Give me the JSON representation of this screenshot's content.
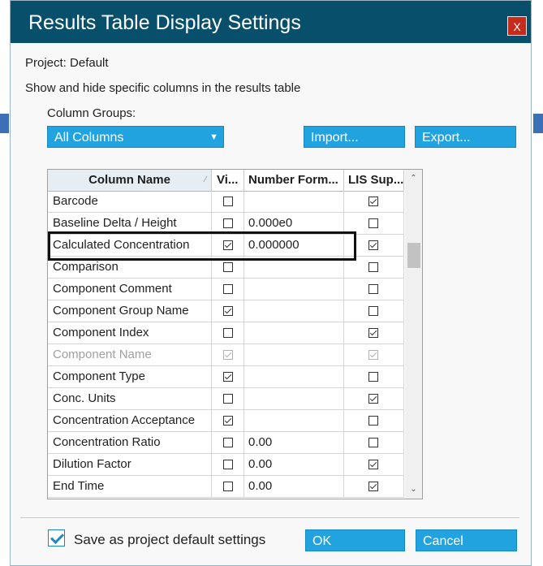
{
  "dialog": {
    "title": "Results Table Display Settings",
    "close_label": "X",
    "project_label": "Project:  Default",
    "description": "Show and hide specific columns in the results table",
    "column_groups_label": "Column Groups:",
    "column_groups_selected": "All Columns",
    "import_label": "Import...",
    "export_label": "Export..."
  },
  "table": {
    "headers": {
      "name": "Column Name",
      "visible": "Vi...",
      "format": "Number  Form...",
      "lis": "LIS  Sup..."
    },
    "rows": [
      {
        "name": "Barcode",
        "visible": false,
        "format": "",
        "lis": true,
        "disabled": false
      },
      {
        "name": "Baseline Delta / Height",
        "visible": false,
        "format": "0.000e0",
        "lis": false,
        "disabled": false
      },
      {
        "name": "Calculated Concentration",
        "visible": true,
        "format": "0.000000",
        "lis": true,
        "disabled": false
      },
      {
        "name": "Comparison",
        "visible": false,
        "format": "",
        "lis": false,
        "disabled": false
      },
      {
        "name": "Component Comment",
        "visible": false,
        "format": "",
        "lis": false,
        "disabled": false
      },
      {
        "name": "Component Group Name",
        "visible": true,
        "format": "",
        "lis": false,
        "disabled": false
      },
      {
        "name": "Component Index",
        "visible": false,
        "format": "",
        "lis": true,
        "disabled": false
      },
      {
        "name": "Component Name",
        "visible": true,
        "format": "",
        "lis": true,
        "disabled": true
      },
      {
        "name": "Component Type",
        "visible": true,
        "format": "",
        "lis": false,
        "disabled": false
      },
      {
        "name": "Conc. Units",
        "visible": false,
        "format": "",
        "lis": true,
        "disabled": false
      },
      {
        "name": "Concentration Acceptance",
        "visible": true,
        "format": "",
        "lis": false,
        "disabled": false
      },
      {
        "name": "Concentration Ratio",
        "visible": false,
        "format": "0.00",
        "lis": false,
        "disabled": false
      },
      {
        "name": "Dilution Factor",
        "visible": false,
        "format": "0.00",
        "lis": true,
        "disabled": false
      },
      {
        "name": "End Time",
        "visible": false,
        "format": "0.00",
        "lis": true,
        "disabled": false
      }
    ]
  },
  "footer": {
    "save_default_label": "Save as project default settings",
    "save_default_checked": true,
    "ok_label": "OK",
    "cancel_label": "Cancel"
  },
  "colors": {
    "titlebar": "#084f6b",
    "button": "#21a3e0",
    "close": "#c42b1c"
  }
}
